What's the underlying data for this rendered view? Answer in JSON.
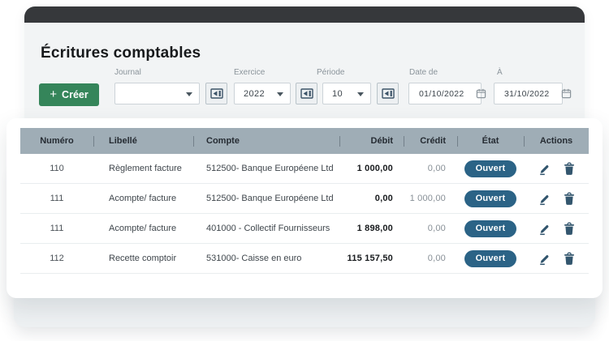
{
  "page": {
    "title": "Écritures comptables"
  },
  "toolbar": {
    "create_label": "Créer",
    "journal": {
      "label": "Journal",
      "value": ""
    },
    "exercice": {
      "label": "Exercice",
      "value": "2022"
    },
    "periode": {
      "label": "Période",
      "value": "10"
    },
    "date_from": {
      "label": "Date de",
      "value": "01/10/2022"
    },
    "date_to": {
      "label": "À",
      "value": "31/10/2022"
    }
  },
  "table": {
    "columns": [
      "Numéro",
      "Libellé",
      "Compte",
      "Débit",
      "Crédit",
      "État",
      "Actions"
    ],
    "rows": [
      {
        "numero": "110",
        "libelle": "Règlement facture",
        "compte": "512500- Banque Européene Ltd",
        "debit": "1 000,00",
        "credit": "0,00",
        "etat": "Ouvert"
      },
      {
        "numero": "111",
        "libelle": "Acompte/ facture",
        "compte": "512500- Banque Européene Ltd",
        "debit": "0,00",
        "credit": "1 000,00",
        "etat": "Ouvert"
      },
      {
        "numero": "111",
        "libelle": "Acompte/ facture",
        "compte": "401000 - Collectif Fournisseurs",
        "debit": "1 898,00",
        "credit": "0,00",
        "etat": "Ouvert"
      },
      {
        "numero": "112",
        "libelle": "Recette comptoir",
        "compte": "531000- Caisse en euro",
        "debit": "115 157,50",
        "credit": "0,00",
        "etat": "Ouvert"
      }
    ]
  },
  "icons": {
    "plus": "plus-icon",
    "chevron": "chevron-down-icon",
    "lookup": "lookup-window-icon",
    "calendar": "calendar-icon",
    "edit": "pencil-icon",
    "delete": "trash-icon"
  },
  "colors": {
    "accent_green": "#35855a",
    "badge_blue": "#2b6386",
    "table_header_gray": "#9fadb6",
    "icon_slate": "#33566e",
    "topbar_dark": "#36383b"
  }
}
